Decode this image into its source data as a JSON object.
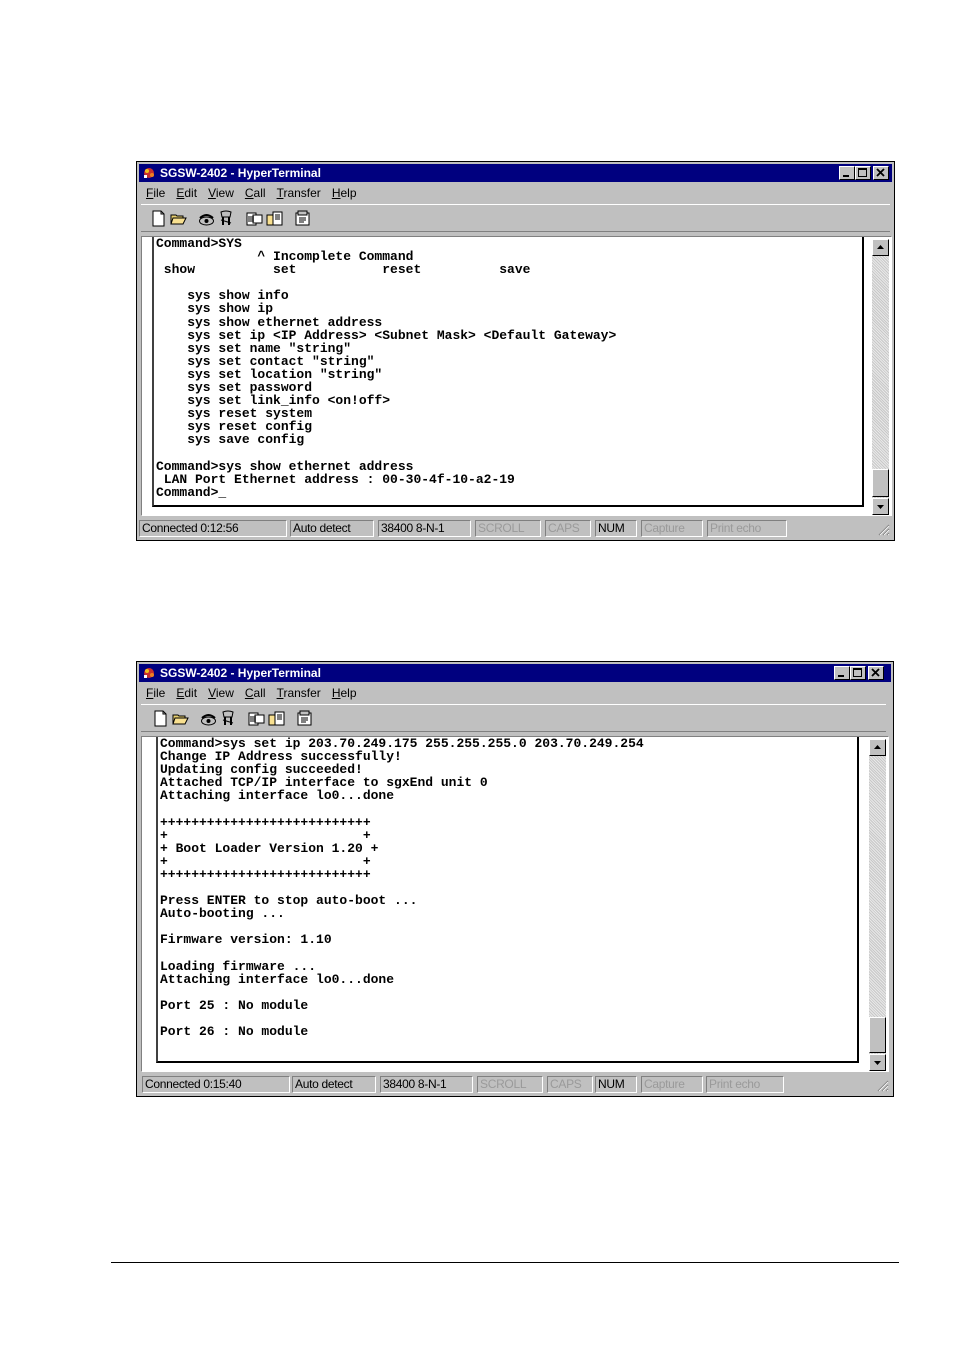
{
  "windows": [
    {
      "title": "SGSW-2402 - HyperTerminal",
      "menu": [
        {
          "label": "File",
          "accel": "F",
          "rest": "ile"
        },
        {
          "label": "Edit",
          "accel": "E",
          "rest": "dit"
        },
        {
          "label": "View",
          "accel": "V",
          "rest": "iew"
        },
        {
          "label": "Call",
          "accel": "C",
          "rest": "all"
        },
        {
          "label": "Transfer",
          "accel": "T",
          "rest": "ransfer"
        },
        {
          "label": "Help",
          "accel": "H",
          "rest": "elp"
        }
      ],
      "terminal_text": "Command>SYS\n             ^ Incomplete Command\n show          set           reset          save\n\n    sys show info\n    sys show ip\n    sys show ethernet address\n    sys set ip <IP Address> <Subnet Mask> <Default Gateway>\n    sys set name \"string\"\n    sys set contact \"string\"\n    sys set location \"string\"\n    sys set password\n    sys set link_info <on!off>\n    sys reset system\n    sys reset config\n    sys save config\n\nCommand>sys show ethernet address\n LAN Port Ethernet address : 00-30-4f-10-a2-19\nCommand>_",
      "status": {
        "connected": "Connected 0:12:56",
        "detect": "Auto detect",
        "port": "38400 8-N-1",
        "scroll": "SCROLL",
        "caps": "CAPS",
        "num": "NUM",
        "capture": "Capture",
        "print_echo": "Print echo"
      }
    },
    {
      "title": "SGSW-2402 - HyperTerminal",
      "menu": [
        {
          "label": "File",
          "accel": "F",
          "rest": "ile"
        },
        {
          "label": "Edit",
          "accel": "E",
          "rest": "dit"
        },
        {
          "label": "View",
          "accel": "V",
          "rest": "iew"
        },
        {
          "label": "Call",
          "accel": "C",
          "rest": "all"
        },
        {
          "label": "Transfer",
          "accel": "T",
          "rest": "ransfer"
        },
        {
          "label": "Help",
          "accel": "H",
          "rest": "elp"
        }
      ],
      "terminal_text": "Command>sys set ip 203.70.249.175 255.255.255.0 203.70.249.254\nChange IP Address successfully!\nUpdating config succeeded!\nAttached TCP/IP interface to sgxEnd unit 0\nAttaching interface lo0...done\n\n+++++++++++++++++++++++++++\n+                         +\n+ Boot Loader Version 1.20 +\n+                         +\n+++++++++++++++++++++++++++\n\nPress ENTER to stop auto-boot ...\nAuto-booting ...\n\nFirmware version: 1.10\n\nLoading firmware ...\nAttaching interface lo0...done\n\nPort 25 : No module\n\nPort 26 : No module\n\n_",
      "status": {
        "connected": "Connected 0:15:40",
        "detect": "Auto detect",
        "port": "38400 8-N-1",
        "scroll": "SCROLL",
        "caps": "CAPS",
        "num": "NUM",
        "capture": "Capture",
        "print_echo": "Print echo"
      }
    }
  ],
  "icons": {
    "app": "hyperterminal-icon",
    "toolbar": [
      "new-icon",
      "open-icon",
      "connect-icon",
      "disconnect-icon",
      "send-icon",
      "receive-icon",
      "properties-icon"
    ]
  }
}
